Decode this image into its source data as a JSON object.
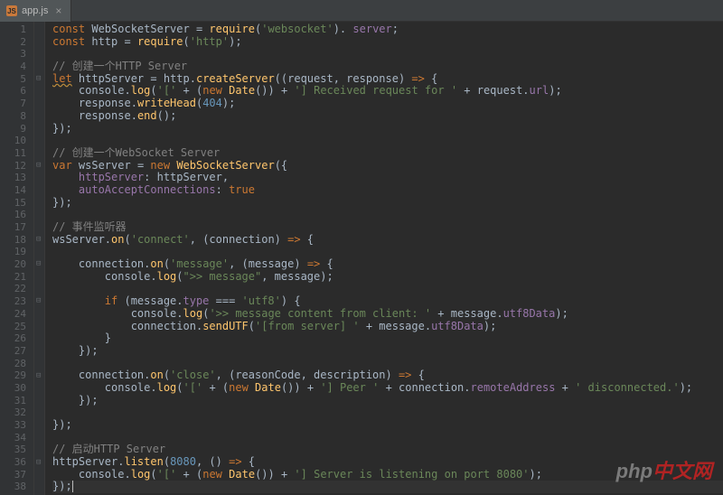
{
  "tab": {
    "filename": "app.js",
    "icon": "js-file-icon"
  },
  "line_count": 38,
  "fold_marks": [
    {
      "line": 5,
      "glyph": "⊟"
    },
    {
      "line": 12,
      "glyph": "⊟"
    },
    {
      "line": 18,
      "glyph": "⊟"
    },
    {
      "line": 20,
      "glyph": "⊟"
    },
    {
      "line": 23,
      "glyph": "⊟"
    },
    {
      "line": 29,
      "glyph": "⊟"
    },
    {
      "line": 36,
      "glyph": "⊟"
    }
  ],
  "code_lines": [
    [
      [
        "kw",
        "const"
      ],
      [
        "ident",
        " WebSocketServer "
      ],
      [
        "punc",
        "= "
      ],
      [
        "fn",
        "require"
      ],
      [
        "punc",
        "("
      ],
      [
        "str",
        "'websocket'"
      ],
      [
        "punc",
        "). "
      ],
      [
        "prop",
        "server"
      ],
      [
        "punc",
        ";"
      ]
    ],
    [
      [
        "kw",
        "const"
      ],
      [
        "ident",
        " http "
      ],
      [
        "punc",
        "= "
      ],
      [
        "fn",
        "require"
      ],
      [
        "punc",
        "("
      ],
      [
        "str",
        "'http'"
      ],
      [
        "punc",
        ");"
      ]
    ],
    [],
    [
      [
        "com",
        "// 创建一个HTTP Server"
      ]
    ],
    [
      [
        "kw warn",
        "let"
      ],
      [
        "ident",
        " httpServer "
      ],
      [
        "punc",
        "= http."
      ],
      [
        "fn",
        "createServer"
      ],
      [
        "punc",
        "((request"
      ],
      [
        "punc",
        ", "
      ],
      [
        "ident",
        "response"
      ],
      [
        "punc",
        ") "
      ],
      [
        "kw",
        "=>"
      ],
      [
        "punc",
        " {"
      ]
    ],
    [
      [
        "ident",
        "    console"
      ],
      [
        "punc",
        "."
      ],
      [
        "fn",
        "log"
      ],
      [
        "punc",
        "("
      ],
      [
        "str",
        "'['"
      ],
      [
        "punc",
        " + ("
      ],
      [
        "kw",
        "new"
      ],
      [
        "ident",
        " "
      ],
      [
        "fn",
        "Date"
      ],
      [
        "punc",
        "()) + "
      ],
      [
        "str",
        "'] Received request for '"
      ],
      [
        "punc",
        " + request."
      ],
      [
        "prop",
        "url"
      ],
      [
        "punc",
        ");"
      ]
    ],
    [
      [
        "ident",
        "    response"
      ],
      [
        "punc",
        "."
      ],
      [
        "fn",
        "writeHead"
      ],
      [
        "punc",
        "("
      ],
      [
        "num",
        "404"
      ],
      [
        "punc",
        ");"
      ]
    ],
    [
      [
        "ident",
        "    response"
      ],
      [
        "punc",
        "."
      ],
      [
        "fn",
        "end"
      ],
      [
        "punc",
        "();"
      ]
    ],
    [
      [
        "punc",
        "});"
      ]
    ],
    [],
    [
      [
        "com",
        "// 创建一个WebSocket Server"
      ]
    ],
    [
      [
        "kw",
        "var"
      ],
      [
        "ident",
        " wsServer "
      ],
      [
        "punc",
        "= "
      ],
      [
        "kw",
        "new"
      ],
      [
        "ident",
        " "
      ],
      [
        "fn",
        "WebSocketServer"
      ],
      [
        "punc",
        "({"
      ]
    ],
    [
      [
        "prop",
        "    httpServer"
      ],
      [
        "punc",
        ": httpServer,"
      ]
    ],
    [
      [
        "prop",
        "    autoAcceptConnections"
      ],
      [
        "punc",
        ": "
      ],
      [
        "bool",
        "true"
      ]
    ],
    [
      [
        "punc",
        "});"
      ]
    ],
    [],
    [
      [
        "com",
        "// 事件监听器"
      ]
    ],
    [
      [
        "ident",
        "wsServer"
      ],
      [
        "punc",
        "."
      ],
      [
        "fn",
        "on"
      ],
      [
        "punc",
        "("
      ],
      [
        "str",
        "'connect'"
      ],
      [
        "punc",
        ", (connection) "
      ],
      [
        "kw",
        "=>"
      ],
      [
        "punc",
        " {"
      ]
    ],
    [],
    [
      [
        "ident",
        "    connection"
      ],
      [
        "punc",
        "."
      ],
      [
        "fn",
        "on"
      ],
      [
        "punc",
        "("
      ],
      [
        "str",
        "'message'"
      ],
      [
        "punc",
        ", (message) "
      ],
      [
        "kw",
        "=>"
      ],
      [
        "punc",
        " {"
      ]
    ],
    [
      [
        "ident",
        "        console"
      ],
      [
        "punc",
        "."
      ],
      [
        "fn",
        "log"
      ],
      [
        "punc",
        "("
      ],
      [
        "str",
        "\">> message\""
      ],
      [
        "punc",
        ", message);"
      ]
    ],
    [],
    [
      [
        "punc",
        "        "
      ],
      [
        "kw",
        "if"
      ],
      [
        "punc",
        " (message."
      ],
      [
        "prop",
        "type"
      ],
      [
        "punc",
        " === "
      ],
      [
        "str",
        "'utf8'"
      ],
      [
        "punc",
        ") {"
      ]
    ],
    [
      [
        "ident",
        "            console"
      ],
      [
        "punc",
        "."
      ],
      [
        "fn",
        "log"
      ],
      [
        "punc",
        "("
      ],
      [
        "str",
        "'>> message content from client: '"
      ],
      [
        "punc",
        " + message."
      ],
      [
        "prop",
        "utf8Data"
      ],
      [
        "punc",
        ");"
      ]
    ],
    [
      [
        "ident",
        "            connection"
      ],
      [
        "punc",
        "."
      ],
      [
        "fn",
        "sendUTF"
      ],
      [
        "punc",
        "("
      ],
      [
        "str",
        "'[from server] '"
      ],
      [
        "punc",
        " + message."
      ],
      [
        "prop",
        "utf8Data"
      ],
      [
        "punc",
        ");"
      ]
    ],
    [
      [
        "punc",
        "        }"
      ]
    ],
    [
      [
        "punc",
        "    });"
      ]
    ],
    [],
    [
      [
        "ident",
        "    connection"
      ],
      [
        "punc",
        "."
      ],
      [
        "fn",
        "on"
      ],
      [
        "punc",
        "("
      ],
      [
        "str",
        "'close'"
      ],
      [
        "punc",
        ", (reasonCode, description) "
      ],
      [
        "kw",
        "=>"
      ],
      [
        "punc",
        " {"
      ]
    ],
    [
      [
        "ident",
        "        console"
      ],
      [
        "punc",
        "."
      ],
      [
        "fn",
        "log"
      ],
      [
        "punc",
        "("
      ],
      [
        "str",
        "'['"
      ],
      [
        "punc",
        " + ("
      ],
      [
        "kw",
        "new"
      ],
      [
        "ident",
        " "
      ],
      [
        "fn",
        "Date"
      ],
      [
        "punc",
        "()) + "
      ],
      [
        "str",
        "'] Peer '"
      ],
      [
        "punc",
        " + connection."
      ],
      [
        "prop",
        "remoteAddress"
      ],
      [
        "punc",
        " + "
      ],
      [
        "str",
        "' disconnected.'"
      ],
      [
        "punc",
        ");"
      ]
    ],
    [
      [
        "punc",
        "    });"
      ]
    ],
    [],
    [
      [
        "punc",
        "});"
      ]
    ],
    [],
    [
      [
        "com",
        "// 启动HTTP Server"
      ]
    ],
    [
      [
        "ident",
        "httpServer"
      ],
      [
        "punc",
        "."
      ],
      [
        "fn",
        "listen"
      ],
      [
        "punc",
        "("
      ],
      [
        "num",
        "8080"
      ],
      [
        "punc",
        ", () "
      ],
      [
        "kw",
        "=>"
      ],
      [
        "punc",
        " {"
      ]
    ],
    [
      [
        "ident",
        "    console"
      ],
      [
        "punc",
        "."
      ],
      [
        "fn",
        "log"
      ],
      [
        "punc",
        "("
      ],
      [
        "str",
        "'['"
      ],
      [
        "punc",
        " + ("
      ],
      [
        "kw",
        "new"
      ],
      [
        "ident",
        " "
      ],
      [
        "fn",
        "Date"
      ],
      [
        "punc",
        "()) + "
      ],
      [
        "str",
        "'] Server is listening on port 8080'"
      ],
      [
        "punc",
        ");"
      ]
    ],
    [
      [
        "punc",
        "});"
      ]
    ]
  ],
  "caret_line": 38,
  "watermark": {
    "part1": "php",
    "part2": "中文网"
  },
  "colors": {
    "background": "#2b2b2b",
    "gutter": "#313335",
    "keyword": "#cc7832",
    "string": "#6a8759",
    "number": "#6897bb",
    "function": "#ffc66d",
    "identifier": "#a9b7c6",
    "comment": "#808080",
    "property": "#9876aa"
  }
}
